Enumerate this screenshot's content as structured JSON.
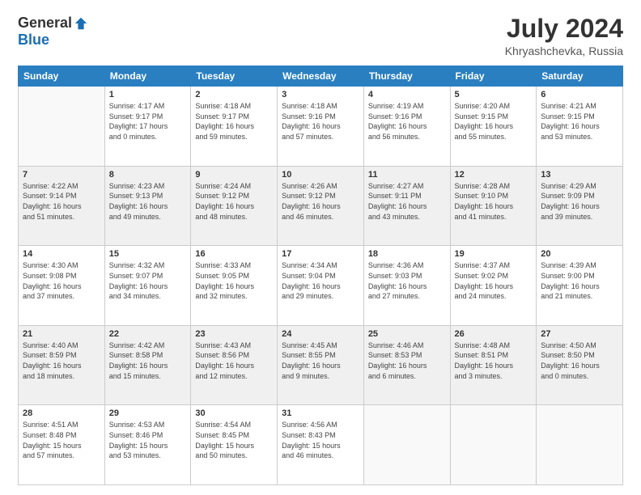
{
  "header": {
    "logo_general": "General",
    "logo_blue": "Blue",
    "title": "July 2024",
    "subtitle": "Khryashchevka, Russia"
  },
  "days_of_week": [
    "Sunday",
    "Monday",
    "Tuesday",
    "Wednesday",
    "Thursday",
    "Friday",
    "Saturday"
  ],
  "weeks": [
    {
      "shade": false,
      "days": [
        {
          "date": "",
          "info": ""
        },
        {
          "date": "1",
          "info": "Sunrise: 4:17 AM\nSunset: 9:17 PM\nDaylight: 17 hours\nand 0 minutes."
        },
        {
          "date": "2",
          "info": "Sunrise: 4:18 AM\nSunset: 9:17 PM\nDaylight: 16 hours\nand 59 minutes."
        },
        {
          "date": "3",
          "info": "Sunrise: 4:18 AM\nSunset: 9:16 PM\nDaylight: 16 hours\nand 57 minutes."
        },
        {
          "date": "4",
          "info": "Sunrise: 4:19 AM\nSunset: 9:16 PM\nDaylight: 16 hours\nand 56 minutes."
        },
        {
          "date": "5",
          "info": "Sunrise: 4:20 AM\nSunset: 9:15 PM\nDaylight: 16 hours\nand 55 minutes."
        },
        {
          "date": "6",
          "info": "Sunrise: 4:21 AM\nSunset: 9:15 PM\nDaylight: 16 hours\nand 53 minutes."
        }
      ]
    },
    {
      "shade": true,
      "days": [
        {
          "date": "7",
          "info": "Sunrise: 4:22 AM\nSunset: 9:14 PM\nDaylight: 16 hours\nand 51 minutes."
        },
        {
          "date": "8",
          "info": "Sunrise: 4:23 AM\nSunset: 9:13 PM\nDaylight: 16 hours\nand 49 minutes."
        },
        {
          "date": "9",
          "info": "Sunrise: 4:24 AM\nSunset: 9:12 PM\nDaylight: 16 hours\nand 48 minutes."
        },
        {
          "date": "10",
          "info": "Sunrise: 4:26 AM\nSunset: 9:12 PM\nDaylight: 16 hours\nand 46 minutes."
        },
        {
          "date": "11",
          "info": "Sunrise: 4:27 AM\nSunset: 9:11 PM\nDaylight: 16 hours\nand 43 minutes."
        },
        {
          "date": "12",
          "info": "Sunrise: 4:28 AM\nSunset: 9:10 PM\nDaylight: 16 hours\nand 41 minutes."
        },
        {
          "date": "13",
          "info": "Sunrise: 4:29 AM\nSunset: 9:09 PM\nDaylight: 16 hours\nand 39 minutes."
        }
      ]
    },
    {
      "shade": false,
      "days": [
        {
          "date": "14",
          "info": "Sunrise: 4:30 AM\nSunset: 9:08 PM\nDaylight: 16 hours\nand 37 minutes."
        },
        {
          "date": "15",
          "info": "Sunrise: 4:32 AM\nSunset: 9:07 PM\nDaylight: 16 hours\nand 34 minutes."
        },
        {
          "date": "16",
          "info": "Sunrise: 4:33 AM\nSunset: 9:05 PM\nDaylight: 16 hours\nand 32 minutes."
        },
        {
          "date": "17",
          "info": "Sunrise: 4:34 AM\nSunset: 9:04 PM\nDaylight: 16 hours\nand 29 minutes."
        },
        {
          "date": "18",
          "info": "Sunrise: 4:36 AM\nSunset: 9:03 PM\nDaylight: 16 hours\nand 27 minutes."
        },
        {
          "date": "19",
          "info": "Sunrise: 4:37 AM\nSunset: 9:02 PM\nDaylight: 16 hours\nand 24 minutes."
        },
        {
          "date": "20",
          "info": "Sunrise: 4:39 AM\nSunset: 9:00 PM\nDaylight: 16 hours\nand 21 minutes."
        }
      ]
    },
    {
      "shade": true,
      "days": [
        {
          "date": "21",
          "info": "Sunrise: 4:40 AM\nSunset: 8:59 PM\nDaylight: 16 hours\nand 18 minutes."
        },
        {
          "date": "22",
          "info": "Sunrise: 4:42 AM\nSunset: 8:58 PM\nDaylight: 16 hours\nand 15 minutes."
        },
        {
          "date": "23",
          "info": "Sunrise: 4:43 AM\nSunset: 8:56 PM\nDaylight: 16 hours\nand 12 minutes."
        },
        {
          "date": "24",
          "info": "Sunrise: 4:45 AM\nSunset: 8:55 PM\nDaylight: 16 hours\nand 9 minutes."
        },
        {
          "date": "25",
          "info": "Sunrise: 4:46 AM\nSunset: 8:53 PM\nDaylight: 16 hours\nand 6 minutes."
        },
        {
          "date": "26",
          "info": "Sunrise: 4:48 AM\nSunset: 8:51 PM\nDaylight: 16 hours\nand 3 minutes."
        },
        {
          "date": "27",
          "info": "Sunrise: 4:50 AM\nSunset: 8:50 PM\nDaylight: 16 hours\nand 0 minutes."
        }
      ]
    },
    {
      "shade": false,
      "days": [
        {
          "date": "28",
          "info": "Sunrise: 4:51 AM\nSunset: 8:48 PM\nDaylight: 15 hours\nand 57 minutes."
        },
        {
          "date": "29",
          "info": "Sunrise: 4:53 AM\nSunset: 8:46 PM\nDaylight: 15 hours\nand 53 minutes."
        },
        {
          "date": "30",
          "info": "Sunrise: 4:54 AM\nSunset: 8:45 PM\nDaylight: 15 hours\nand 50 minutes."
        },
        {
          "date": "31",
          "info": "Sunrise: 4:56 AM\nSunset: 8:43 PM\nDaylight: 15 hours\nand 46 minutes."
        },
        {
          "date": "",
          "info": ""
        },
        {
          "date": "",
          "info": ""
        },
        {
          "date": "",
          "info": ""
        }
      ]
    }
  ]
}
